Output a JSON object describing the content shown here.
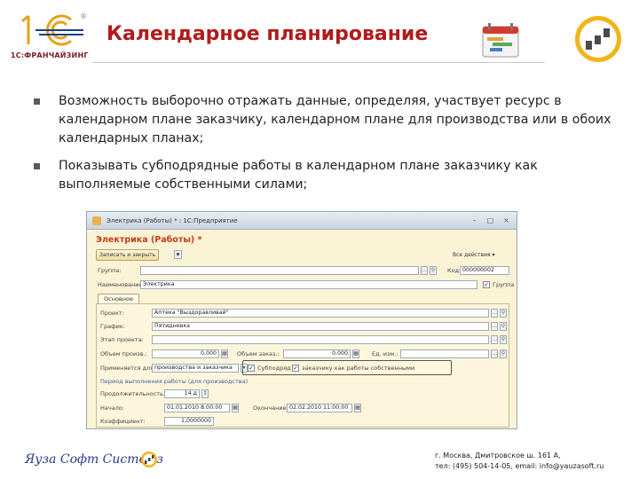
{
  "header": {
    "logo_sub": "1С:ФРАНЧАЙЗИНГ",
    "title": "Календарное планирование",
    "colors": {
      "title": "#b01c1c",
      "logo": "#1a3f8a",
      "accent": "#e7a21a"
    }
  },
  "bullets": [
    "Возможность выборочно отражать данные, определяя, участвует ресурс в календарном плане заказчику, календарном плане для производства или в обоих календарных планах;",
    "Показывать субподрядные работы в календарном плане заказчику как выполняемые собственными силами;"
  ],
  "window": {
    "title": "Электрика (Работы) * : 1С:Предприятие",
    "heading": "Электрика (Работы) *",
    "toolbar": {
      "save_close": "Записать и закрыть",
      "all_actions": "Все действия ▾"
    },
    "fields": {
      "group_label": "Группа:",
      "code_label": "Код:",
      "code_value": "000000002",
      "name_label": "Наименование:",
      "name_value": "Электрика",
      "group_check_label": "Группа",
      "tab_main": "Основное",
      "project_label": "Проект:",
      "project_value": "Аптека \"Выздоравливай\"",
      "schedule_label": "График:",
      "schedule_value": "Пятидневка",
      "stage_label": "Этап проекта:",
      "volume_plan_label": "Объем произв.:",
      "volume_plan_value": "0,000",
      "volume_order_label": "Объем заказ.:",
      "volume_order_value": "0,000",
      "unit_label": "Ед. изм.:",
      "applies_label": "Применяется для:",
      "production_and_customer": "производства и заказчика",
      "subcontract_label": "Субподряд",
      "own_forces_label": "заказчику как работы собственными",
      "period_section": "Период выполнения работы (для производства)",
      "duration_label": "Продолжительность:",
      "duration_value": "14 д",
      "start_label": "Начало:",
      "start_value": "01.01.2010 8:00:00",
      "end_label": "Окончание:",
      "end_value": "02.02.2010 11:00:00",
      "coefficient_label": "Коэффициент:",
      "coefficient_value": "1,0000000"
    }
  },
  "footer": {
    "brand": "Яуза Софт Системз",
    "address_line1": "г. Москва, Дмитровское ш. 161 А,",
    "address_line2": "тел: (495) 504-14-05, email: info@yauzasoft.ru"
  }
}
